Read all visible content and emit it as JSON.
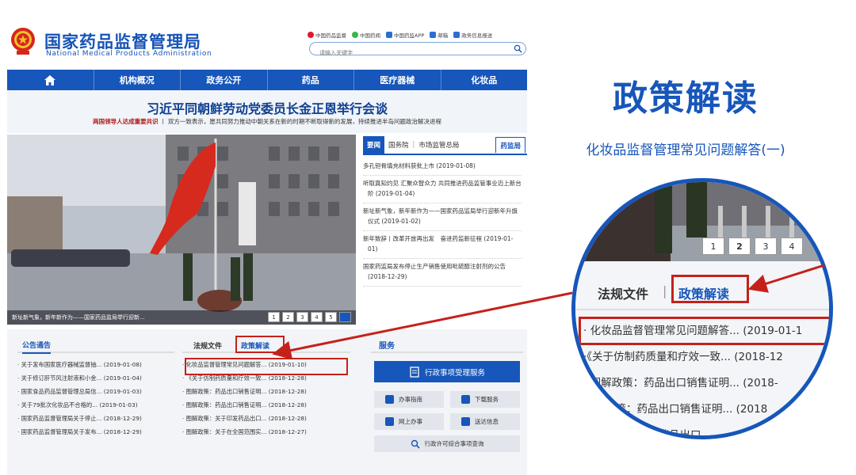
{
  "header": {
    "title": "国家药品监督管理局",
    "subtitle": "National Medical Products Administration",
    "quick_links": [
      "中国药品监督",
      "中国药闻",
      "中国药监APP",
      "邮箱",
      "政务信息报送"
    ],
    "search_placeholder": "请输入关键字"
  },
  "nav": {
    "items": [
      "机构概况",
      "政务公开",
      "药品",
      "医疗器械",
      "化妆品"
    ]
  },
  "headline": {
    "title": "习近平同朝鲜劳动党委员长金正恩举行会谈",
    "sub_bold": "两国领导人达成重要共识",
    "sub_rest": "丨 双方一致表示，愿共同努力推动中朝关系在新的时期不断取得新的发展，持续推进半岛问题政治解决进程"
  },
  "slider": {
    "caption": "新址新气象，新年新作为——国家药品监局举行迎新...",
    "pages": [
      "1",
      "2",
      "3",
      "4",
      "5"
    ]
  },
  "news": {
    "tabs": [
      "要闻",
      "国务院",
      "市场监管总局",
      "药监局"
    ],
    "items": [
      "多孔钽骨填充材料获批上市 (2019-01-08)",
      "听取真知灼见 汇聚众智众力 共同推进药品监管事业迈上新台阶 (2019-01-04)",
      "新址新气象，新年新作为——国家药品监局举行迎新年升旗仪式 (2019-01-02)",
      "新年致辞丨改革开放再出发　奋进药监新征程 (2019-01-01)",
      "国家药监局发布停止生产销售使用吡硫醇注射剂的公告 (2018-12-29)"
    ]
  },
  "notices": {
    "title": "公告通告",
    "items": [
      "关于发布国家医疗器械监督抽... (2019-01-08)",
      "关于修订肝节风注射液和小金... (2019-01-04)",
      "国家食品药品监督管理总局信... (2019-01-03)",
      "关于79批次化妆品不合格的... (2019-01-03)",
      "国家药品监督管理局关于停止... (2018-12-29)",
      "国家药品监督管理局关于发布... (2018-12-29)"
    ]
  },
  "policy": {
    "tab_laws": "法规文件",
    "tab_interp": "政策解读",
    "items": [
      "化妆品监督管理常见问题解答... (2019-01-10)",
      "《关于仿制药质量和疗效一致... (2018-12-28)",
      "图解政策：药品出口销售证明... (2018-12-28)",
      "图解政策：药品出口销售证明... (2018-12-28)",
      "图解政策：关于印发药品出口... (2018-12-28)",
      "图解政策：关于在全国范围实... (2018-12-27)"
    ]
  },
  "service": {
    "title": "服务",
    "main_button": "行政事项受理服务",
    "buttons": [
      "办事指南",
      "下载服务",
      "网上办事",
      "送达信息"
    ],
    "wide_button": "行政许可综合事项查询"
  },
  "callout": {
    "title": "政策解读",
    "subtitle": "化妆品监督管理常见问题解答(一)"
  },
  "zoom": {
    "pages": [
      "1",
      "2",
      "3",
      "4"
    ],
    "tab_laws": "法规文件",
    "tab_sep": "|",
    "tab_interp": "政策解读",
    "items": [
      "· 化妆品监督管理常见问题解答... (2019-01-1",
      "·《关于仿制药质量和疗效一致... (2018-12",
      "· 图解政策：药品出口销售证明... (2018-",
      "  图解政策：药品出口销售证明... (2018",
      "  政策：关于印发药品出口"
    ]
  },
  "colors": {
    "brand_blue": "#1756ba",
    "highlight_red": "#c5211b"
  }
}
